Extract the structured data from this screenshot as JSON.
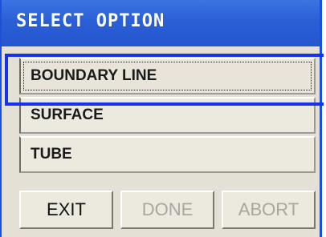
{
  "window": {
    "title": "SELECT OPTION"
  },
  "options": [
    {
      "label": "BOUNDARY LINE",
      "selected": true
    },
    {
      "label": "SURFACE",
      "selected": false
    },
    {
      "label": "TUBE",
      "selected": false
    }
  ],
  "buttons": {
    "exit": {
      "label": "EXIT",
      "enabled": true
    },
    "done": {
      "label": "DONE",
      "enabled": false
    },
    "abort": {
      "label": "ABORT",
      "enabled": false
    }
  },
  "colors": {
    "titlebar": "#2a5fd6",
    "highlight": "#1432e8",
    "panel": "#e4e0d6"
  }
}
